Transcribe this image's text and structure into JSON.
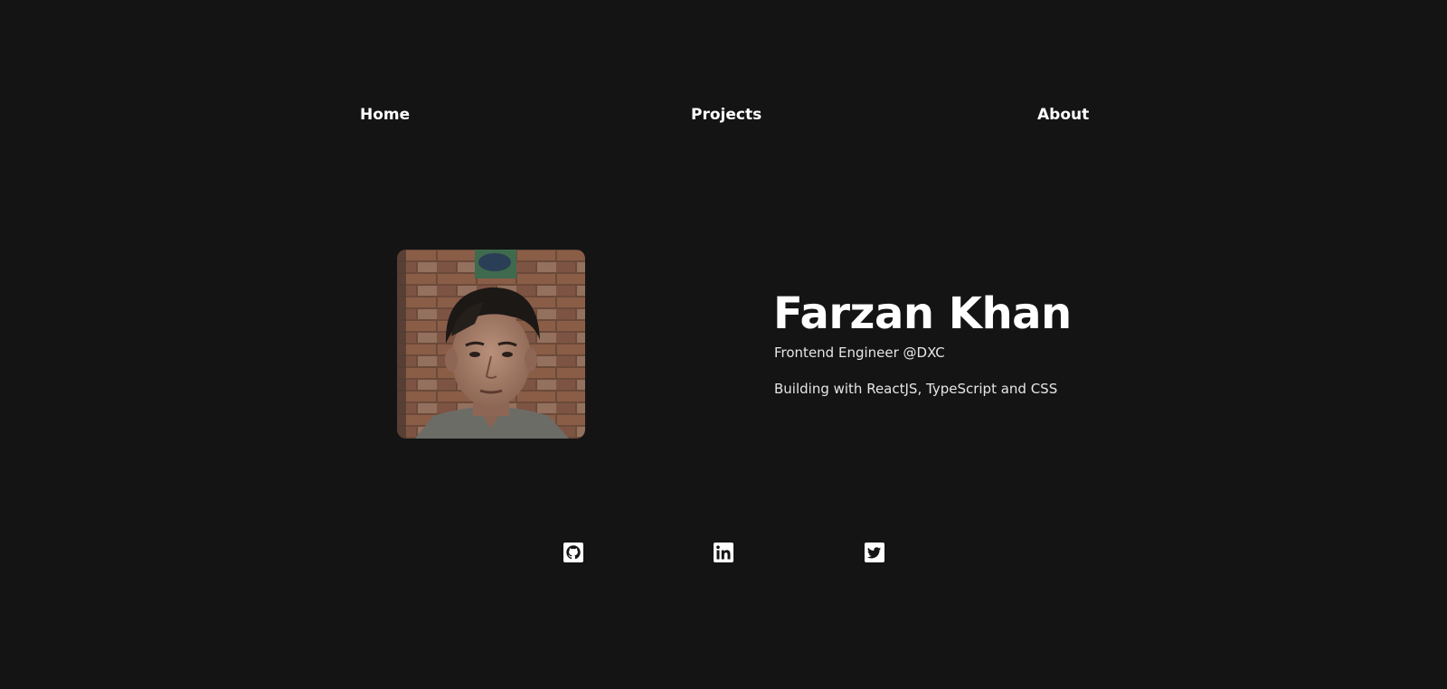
{
  "nav": {
    "home": "Home",
    "projects": "Projects",
    "about": "About"
  },
  "profile": {
    "name": "Farzan Khan",
    "role": "Frontend Engineer @DXC",
    "stack": "Building with ReactJS, TypeScript and CSS"
  },
  "social": [
    {
      "icon": "github-icon"
    },
    {
      "icon": "linkedin-icon"
    },
    {
      "icon": "twitter-icon"
    }
  ],
  "colors": {
    "background": "#141414",
    "text": "#ffffff",
    "muted_text": "#e6e6e6"
  }
}
